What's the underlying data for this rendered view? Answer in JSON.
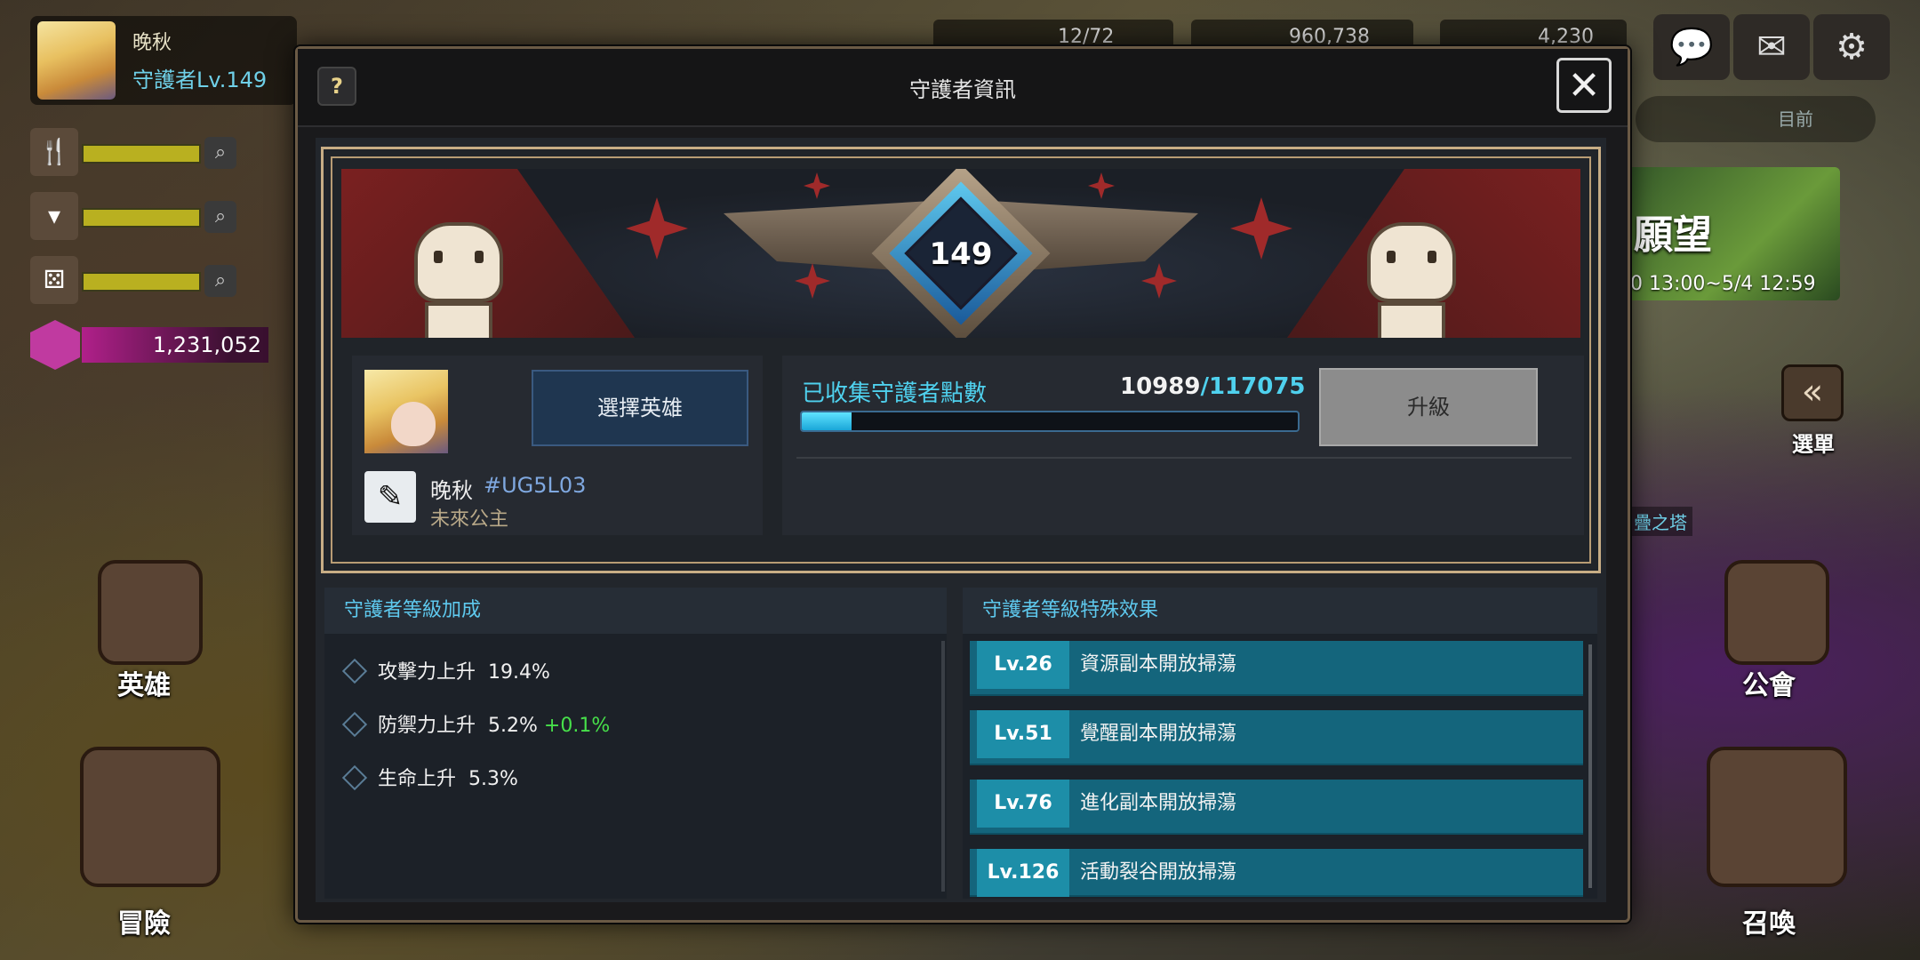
{
  "hud": {
    "player_name": "晚秋",
    "player_level": "守護者Lv.149",
    "gems": "1,231,052",
    "resources": [
      "12/72",
      "960,738",
      "4,230"
    ],
    "goal_label": "目前",
    "event_title": "願望",
    "event_dates": "0 13:00~5/4 12:59",
    "menu_label": "選單",
    "tower_label": "疊之塔"
  },
  "side": {
    "hero": "英雄",
    "adventure": "冒險",
    "guild": "公會",
    "summon": "召喚"
  },
  "modal": {
    "title": "守護者資訊",
    "help": "?",
    "close": "✕",
    "level": "149",
    "select_hero": "選擇英雄",
    "name": "晚秋",
    "tag": "#UG5L03",
    "profile_title": "未來公主",
    "points_label": "已收集守護者點數",
    "points_current": "10989",
    "points_total": "/117075",
    "points_progress": 0.0939,
    "upgrade": "升級"
  },
  "bonus_panel": {
    "title": "守護者等級加成",
    "items": [
      {
        "label": "攻擊力上升",
        "value": "19.4%",
        "extra": ""
      },
      {
        "label": "防禦力上升",
        "value": "5.2%",
        "extra": "+0.1%"
      },
      {
        "label": "生命上升",
        "value": "5.3%",
        "extra": ""
      }
    ]
  },
  "effects_panel": {
    "title": "守護者等級特殊效果",
    "items": [
      {
        "lv": "Lv.26",
        "text": "資源副本開放掃蕩"
      },
      {
        "lv": "Lv.51",
        "text": "覺醒副本開放掃蕩"
      },
      {
        "lv": "Lv.76",
        "text": "進化副本開放掃蕩"
      },
      {
        "lv": "Lv.126",
        "text": "活動裂谷開放掃蕩"
      }
    ]
  },
  "colors": {
    "accent": "#4fd1ee",
    "upgrade_disabled": "#8c8c8c",
    "effect_row": "#14657c",
    "positive": "#47e04a"
  }
}
